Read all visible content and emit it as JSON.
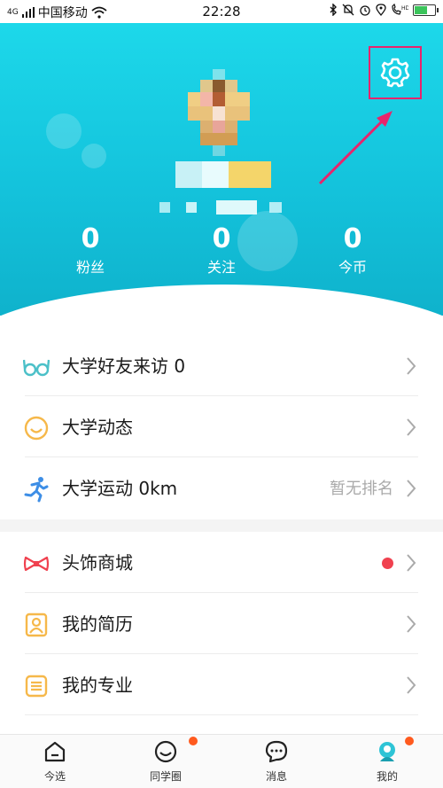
{
  "status_bar": {
    "signal_type": "4G",
    "carrier": "中国移动",
    "time": "22:28"
  },
  "header": {
    "settings_icon": "gear-icon",
    "stats": [
      {
        "value": "0",
        "label": "粉丝"
      },
      {
        "value": "0",
        "label": "关注"
      },
      {
        "value": "0",
        "label": "今币"
      }
    ]
  },
  "menu_group_1": [
    {
      "title": "大学好友来访  0",
      "icon": "glasses-icon",
      "extra": ""
    },
    {
      "title": "大学动态",
      "icon": "smile-icon",
      "extra": ""
    },
    {
      "title": "大学运动  0km",
      "icon": "runner-icon",
      "extra": "暂无排名"
    }
  ],
  "menu_group_2": [
    {
      "title": "头饰商城",
      "icon": "bow-icon",
      "has_dot": true
    },
    {
      "title": "我的简历",
      "icon": "resume-icon",
      "has_dot": false
    },
    {
      "title": "我的专业",
      "icon": "list-icon",
      "has_dot": false
    }
  ],
  "tabs": [
    {
      "label": "今选",
      "icon": "home-icon",
      "badge": false
    },
    {
      "label": "同学圈",
      "icon": "smile-icon",
      "badge": true
    },
    {
      "label": "消息",
      "icon": "message-icon",
      "badge": false
    },
    {
      "label": "我的",
      "icon": "profile-icon",
      "badge": true,
      "active": true
    }
  ],
  "colors": {
    "header_top": "#1dd8ea",
    "header_bottom": "#0fb2cc",
    "highlight": "#e8246c",
    "badge": "#ff5a1e",
    "dot": "#f0414f"
  }
}
